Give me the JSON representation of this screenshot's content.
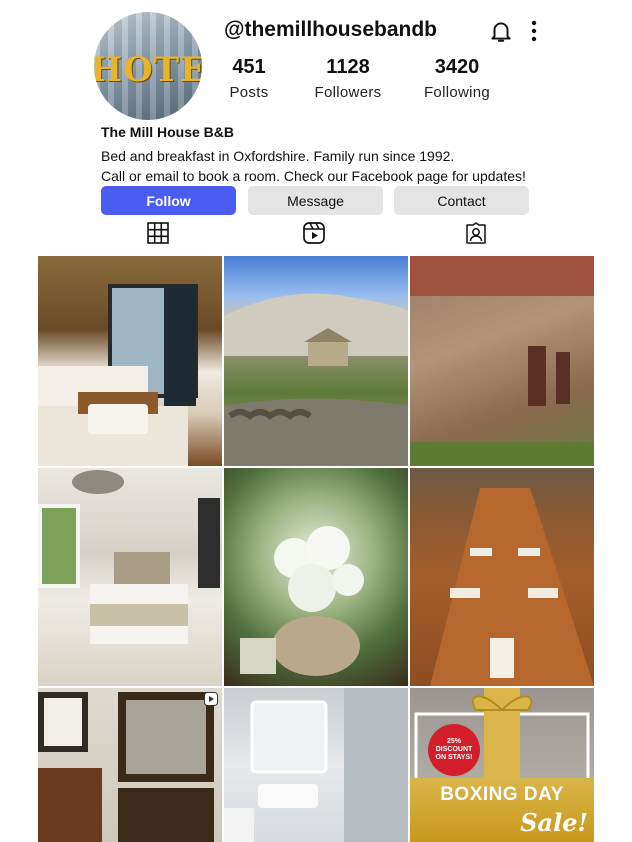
{
  "profile": {
    "handle": "@themillhousebandb",
    "avatar_sign": "HOTEL",
    "display_name": "The Mill House B&B",
    "bio_line1": "Bed and breakfast in Oxfordshire. Family run since 1992.",
    "bio_line2": "Call or email to book a room. Check our Facebook page for updates!"
  },
  "stats": [
    {
      "value": "451",
      "label": "Posts"
    },
    {
      "value": "1128",
      "label": "Followers"
    },
    {
      "value": "3420",
      "label": "Following"
    }
  ],
  "actions": {
    "follow": "Follow",
    "message": "Message",
    "contact": "Contact"
  },
  "header_icons": [
    "bell-icon",
    "more-vertical-icon"
  ],
  "tabs": [
    "grid-icon",
    "reels-icon",
    "tagged-icon"
  ],
  "colors": {
    "follow_button": "#4a5cf2",
    "secondary_button": "#e4e4e4",
    "promo_gold": "#c9981b",
    "badge_red": "#d21f2b"
  },
  "posts": [
    {
      "subject": "hotel-bedroom-twin-beds"
    },
    {
      "subject": "countryside-stone-barn"
    },
    {
      "subject": "brick-and-flint-wall"
    },
    {
      "subject": "guest-bedroom-double-bed"
    },
    {
      "subject": "flower-arrangement"
    },
    {
      "subject": "dining-table-set"
    },
    {
      "subject": "framed-pictures-wall",
      "reel": true
    },
    {
      "subject": "bathroom-sink-mirror"
    },
    {
      "subject": "boxing-day-promo"
    }
  ],
  "promo": {
    "badge_line1": "25% DISCOUNT",
    "badge_line2": "ON STAYS!",
    "title": "BOXING DAY",
    "subtitle": "Sale!"
  }
}
